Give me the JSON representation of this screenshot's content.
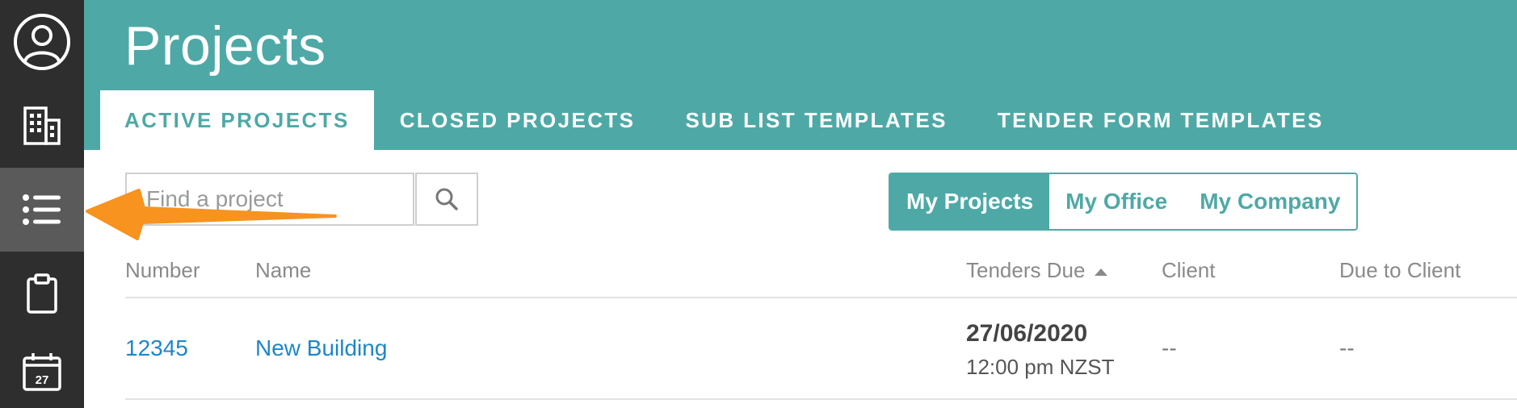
{
  "rail": {
    "items": [
      {
        "icon": "user-circle-icon"
      },
      {
        "icon": "building-icon"
      },
      {
        "icon": "list-icon",
        "active": true
      },
      {
        "icon": "clipboard-icon"
      },
      {
        "icon": "calendar-icon",
        "day": "27"
      }
    ]
  },
  "header": {
    "title": "Projects",
    "tabs": [
      {
        "label": "ACTIVE PROJECTS",
        "active": true
      },
      {
        "label": "CLOSED PROJECTS"
      },
      {
        "label": "SUB LIST TEMPLATES"
      },
      {
        "label": "TENDER FORM TEMPLATES"
      }
    ]
  },
  "search": {
    "placeholder": "Find a project",
    "value": "",
    "button_icon": "search-icon"
  },
  "filter": {
    "options": [
      "My Projects",
      "My Office",
      "My Company"
    ],
    "selected": "My Projects"
  },
  "table": {
    "columns": {
      "number": "Number",
      "name": "Name",
      "tenders_due": "Tenders Due",
      "client": "Client",
      "due_to_client": "Due to Client"
    },
    "sorted_by": "tenders_due",
    "sort_direction": "ascending",
    "rows": [
      {
        "number": "12345",
        "name": "New Building",
        "tenders_due_date": "27/06/2020",
        "tenders_due_time": "12:00 pm NZST",
        "client": "--",
        "due_to_client": "--"
      }
    ]
  },
  "colors": {
    "brand": "#4ea9a6",
    "rail": "#2e2e2e",
    "rail_active": "#5a5a5a",
    "link": "#1e86c8",
    "annotation_arrow": "#f7931e"
  }
}
